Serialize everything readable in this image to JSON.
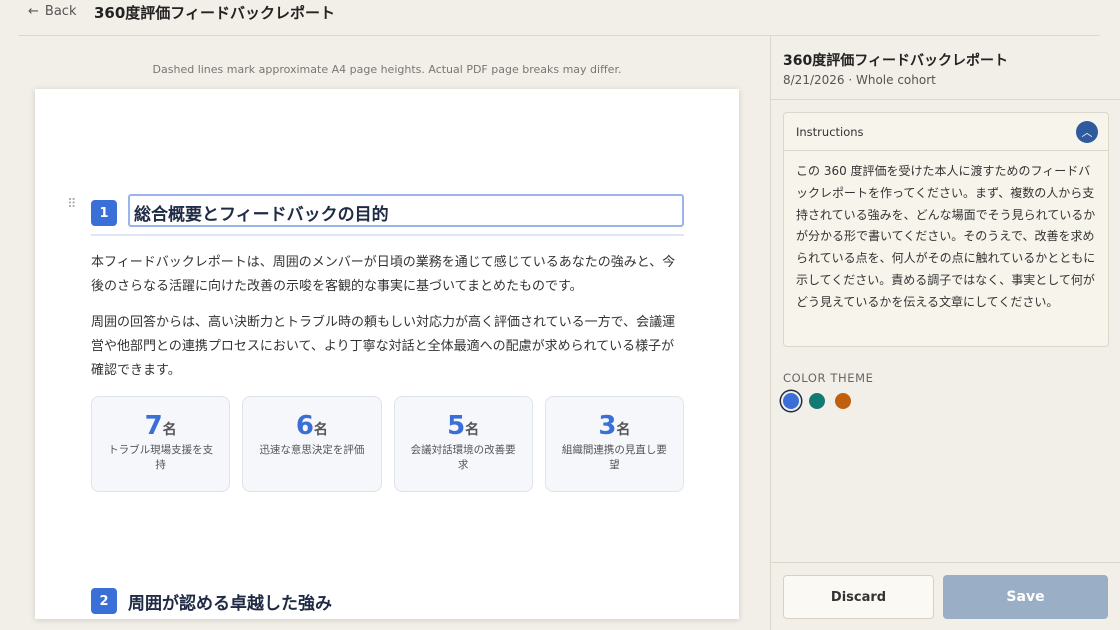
{
  "topbar": {
    "back_label": "Back",
    "back_icon": "←",
    "title": "360度評価フィードバックレポート"
  },
  "hint": "Dashed lines mark approximate A4 page heights. Actual PDF page breaks may differ.",
  "document": {
    "drag_handle": "⠿",
    "sections": [
      {
        "number": "1",
        "title": "総合概要とフィードバックの目的",
        "paragraphs": [
          "本フィードバックレポートは、周囲のメンバーが日頃の業務を通じて感じているあなたの強みと、今後のさらなる活躍に向けた改善の示唆を客観的な事実に基づいてまとめたものです。",
          "周囲の回答からは、高い決断力とトラブル時の頼もしい対応力が高く評価されている一方で、会議運営や他部門との連携プロセスにおいて、より丁寧な対話と全体最適への配慮が求められている様子が確認できます。"
        ],
        "stats": [
          {
            "value": "7",
            "unit": "名",
            "label": "トラブル現場支援を支持"
          },
          {
            "value": "6",
            "unit": "名",
            "label": "迅速な意思決定を評価"
          },
          {
            "value": "5",
            "unit": "名",
            "label": "会議対話環境の改善要求"
          },
          {
            "value": "3",
            "unit": "名",
            "label": "組織間連携の見直し要望"
          }
        ]
      },
      {
        "number": "2",
        "title": "周囲が認める卓越した強み"
      }
    ]
  },
  "sidebar": {
    "title": "360度評価フィードバックレポート",
    "meta": "8/21/2026 · Whole cohort",
    "instructions": {
      "label": "Instructions",
      "toggle_icon": "︿",
      "text": "この 360 度評価を受けた本人に渡すためのフィードバックレポートを作ってください。まず、複数の人から支持されている強みを、どんな場面でそう見られているかが分かる形で書いてください。そのうえで、改善を求められている点を、何人がその点に触れているかとともに示してください。責める調子ではなく、事実として何がどう見えているかを伝える文章にしてください。"
    },
    "color_theme": {
      "label": "COLOR THEME",
      "swatches": [
        {
          "color": "#3a6fd8",
          "selected": true
        },
        {
          "color": "#127a72",
          "selected": false
        },
        {
          "color": "#c0600e",
          "selected": false
        }
      ]
    },
    "discard_label": "Discard",
    "save_label": "Save"
  }
}
